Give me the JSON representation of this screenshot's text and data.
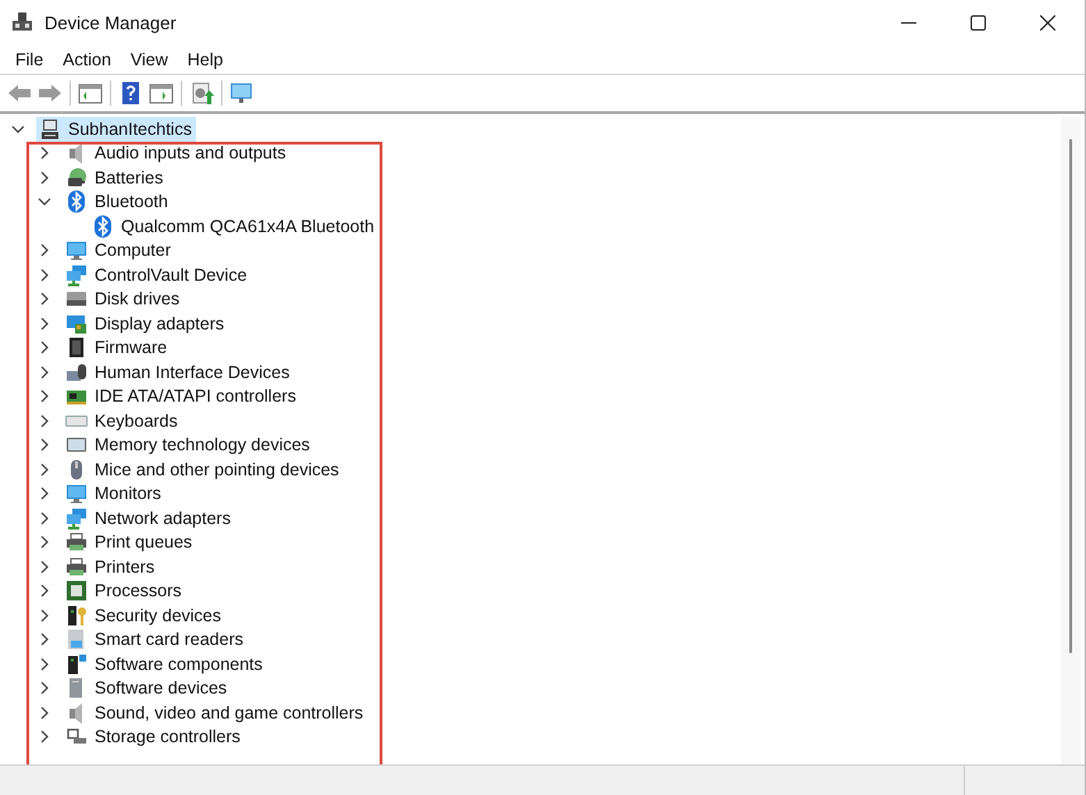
{
  "window": {
    "title": "Device Manager"
  },
  "menu": [
    "File",
    "Action",
    "View",
    "Help"
  ],
  "tree": {
    "root": {
      "label": "SubhanItechtics",
      "expanded": true,
      "selected": true,
      "children": [
        {
          "label": "Audio inputs and outputs",
          "expanded": false,
          "selected": false
        },
        {
          "label": "Batteries",
          "expanded": false,
          "selected": false
        },
        {
          "label": "Bluetooth",
          "expanded": true,
          "selected": false,
          "children": [
            {
              "label": "Qualcomm QCA61x4A Bluetooth",
              "selected": false
            }
          ]
        },
        {
          "label": "Computer",
          "expanded": false,
          "selected": false
        },
        {
          "label": "ControlVault Device",
          "expanded": false,
          "selected": false
        },
        {
          "label": "Disk drives",
          "expanded": false,
          "selected": false
        },
        {
          "label": "Display adapters",
          "expanded": false,
          "selected": false
        },
        {
          "label": "Firmware",
          "expanded": false,
          "selected": false
        },
        {
          "label": "Human Interface Devices",
          "expanded": false,
          "selected": false
        },
        {
          "label": "IDE ATA/ATAPI controllers",
          "expanded": false,
          "selected": false
        },
        {
          "label": "Keyboards",
          "expanded": false,
          "selected": false
        },
        {
          "label": "Memory technology devices",
          "expanded": false,
          "selected": false
        },
        {
          "label": "Mice and other pointing devices",
          "expanded": false,
          "selected": false
        },
        {
          "label": "Monitors",
          "expanded": false,
          "selected": false
        },
        {
          "label": "Network adapters",
          "expanded": false,
          "selected": false
        },
        {
          "label": "Print queues",
          "expanded": false,
          "selected": false
        },
        {
          "label": "Printers",
          "expanded": false,
          "selected": false
        },
        {
          "label": "Processors",
          "expanded": false,
          "selected": false
        },
        {
          "label": "Security devices",
          "expanded": false,
          "selected": false
        },
        {
          "label": "Smart card readers",
          "expanded": false,
          "selected": false
        },
        {
          "label": "Software components",
          "expanded": false,
          "selected": false
        },
        {
          "label": "Software devices",
          "expanded": false,
          "selected": false
        },
        {
          "label": "Sound, video and game controllers",
          "expanded": false,
          "selected": false
        },
        {
          "label": "Storage controllers",
          "expanded": false,
          "selected": false
        }
      ]
    }
  }
}
